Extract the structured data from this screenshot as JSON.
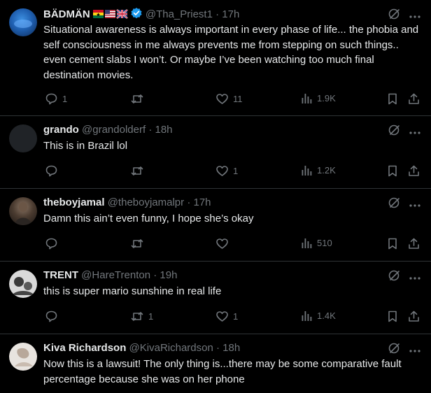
{
  "tweets": [
    {
      "name": "BÄDMÄN",
      "handle": "@Tha_Priest1",
      "time": "17h",
      "text": "Situational awareness is always important in every phase of life... the phobia and self consciousness in me always prevents me from stepping on such things.. even cement slabs I won’t. Or maybe I’ve been watching too much final destination movies.",
      "replies": "1",
      "reposts": "",
      "likes": "11",
      "views": "1.9K",
      "verified": true,
      "flags": [
        "ghana-flag",
        "us-flag",
        "uk-flag"
      ]
    },
    {
      "name": "grando",
      "handle": "@grandolderf",
      "time": "18h",
      "text": "This is in Brazil lol",
      "replies": "",
      "reposts": "",
      "likes": "1",
      "views": "1.2K"
    },
    {
      "name": "theboyjamal",
      "handle": "@theboyjamalpr",
      "time": "17h",
      "text": "Damn this ain’t even funny, I hope she’s okay",
      "replies": "",
      "reposts": "",
      "likes": "",
      "views": "510"
    },
    {
      "name": "TRENT",
      "handle": "@HareTrenton",
      "time": "19h",
      "text": "this is super mario sunshine in real life",
      "replies": "",
      "reposts": "1",
      "likes": "1",
      "views": "1.4K"
    },
    {
      "name": "Kiva Richardson",
      "handle": "@KivaRichardson",
      "time": "18h",
      "text": "Now this is a lawsuit! The only thing is...there may be some comparative fault percentage because she was on her phone",
      "replies": "",
      "reposts": "",
      "likes": "",
      "views": ""
    }
  ],
  "separator": "·",
  "icons": {
    "reply": "reply-icon",
    "repost": "repost-icon",
    "like": "like-icon",
    "views": "views-icon",
    "bookmark": "bookmark-icon",
    "share": "share-icon",
    "grok": "grok-icon",
    "more": "more-icon",
    "verified": "verified-badge-icon"
  },
  "colors": {
    "background": "#000000",
    "text": "#e7e9ea",
    "muted": "#71767b",
    "divider": "#2f3336",
    "verified": "#1d9bf0"
  }
}
